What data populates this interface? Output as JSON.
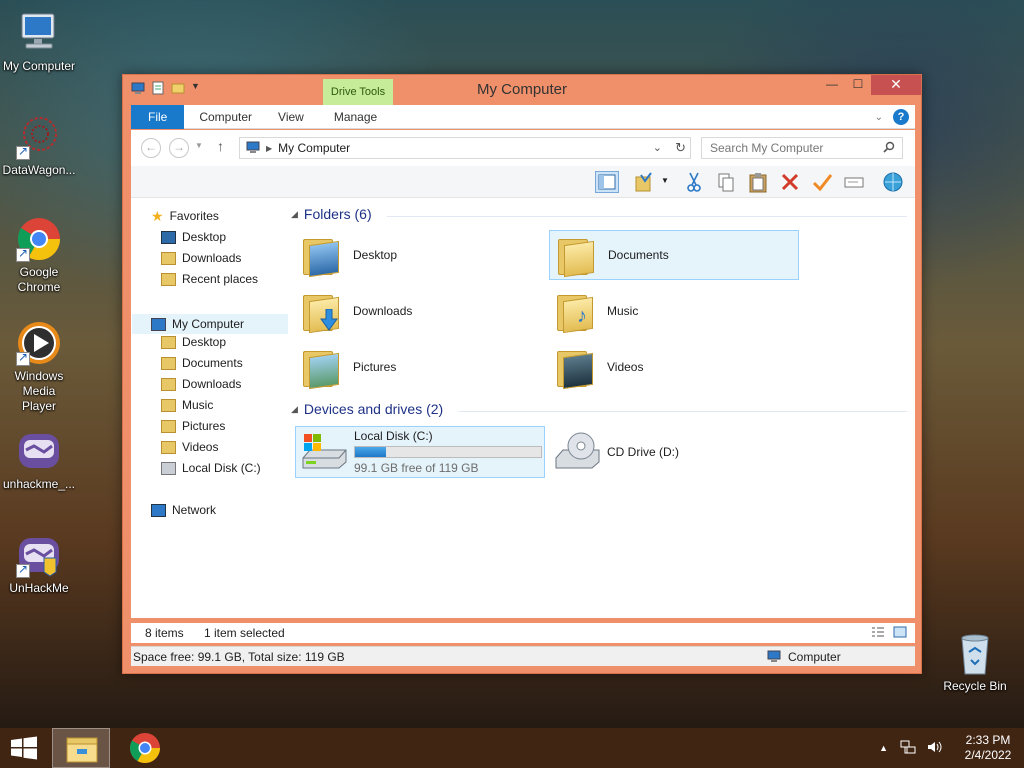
{
  "desktop": {
    "icons": [
      {
        "label": "My Computer"
      },
      {
        "label": "DataWagon..."
      },
      {
        "label": "Google Chrome"
      },
      {
        "label": "Windows Media Player"
      },
      {
        "label": "unhackme_..."
      },
      {
        "label": "UnHackMe"
      }
    ],
    "recycle_bin": "Recycle Bin"
  },
  "window": {
    "title": "My Computer",
    "contextual_tab_group": "Drive Tools",
    "tabs": [
      "File",
      "Computer",
      "View",
      "Manage"
    ],
    "address_path": "My Computer",
    "search_placeholder": "Search My Computer",
    "navigation": {
      "favorites_header": "Favorites",
      "favorites": [
        "Desktop",
        "Downloads",
        "Recent places"
      ],
      "computer_header": "My Computer",
      "computer_items": [
        "Desktop",
        "Documents",
        "Downloads",
        "Music",
        "Pictures",
        "Videos",
        "Local Disk (C:)"
      ],
      "network": "Network"
    },
    "content": {
      "folders_header": "Folders (6)",
      "folders": [
        "Desktop",
        "Documents",
        "Downloads",
        "Music",
        "Pictures",
        "Videos"
      ],
      "selected_folder": "Documents",
      "devices_header": "Devices and drives (2)",
      "drives": [
        {
          "name": "Local Disk (C:)",
          "free_text": "99.1 GB free of 119 GB",
          "used_fraction": 0.167
        },
        {
          "name": "CD Drive (D:)"
        }
      ]
    },
    "status": {
      "item_count": "8 items",
      "selection": "1 item selected",
      "space": "Space free: 99.1 GB, Total size: 119 GB",
      "location": "Computer"
    }
  },
  "taskbar": {
    "time": "2:33 PM",
    "date": "2/4/2022"
  },
  "colors": {
    "accent": "#1979ca",
    "window_frame": "#f0906a",
    "close_button": "#c75050",
    "drive_tools": "#c6ec9a",
    "selection": "#e5f3fb"
  }
}
